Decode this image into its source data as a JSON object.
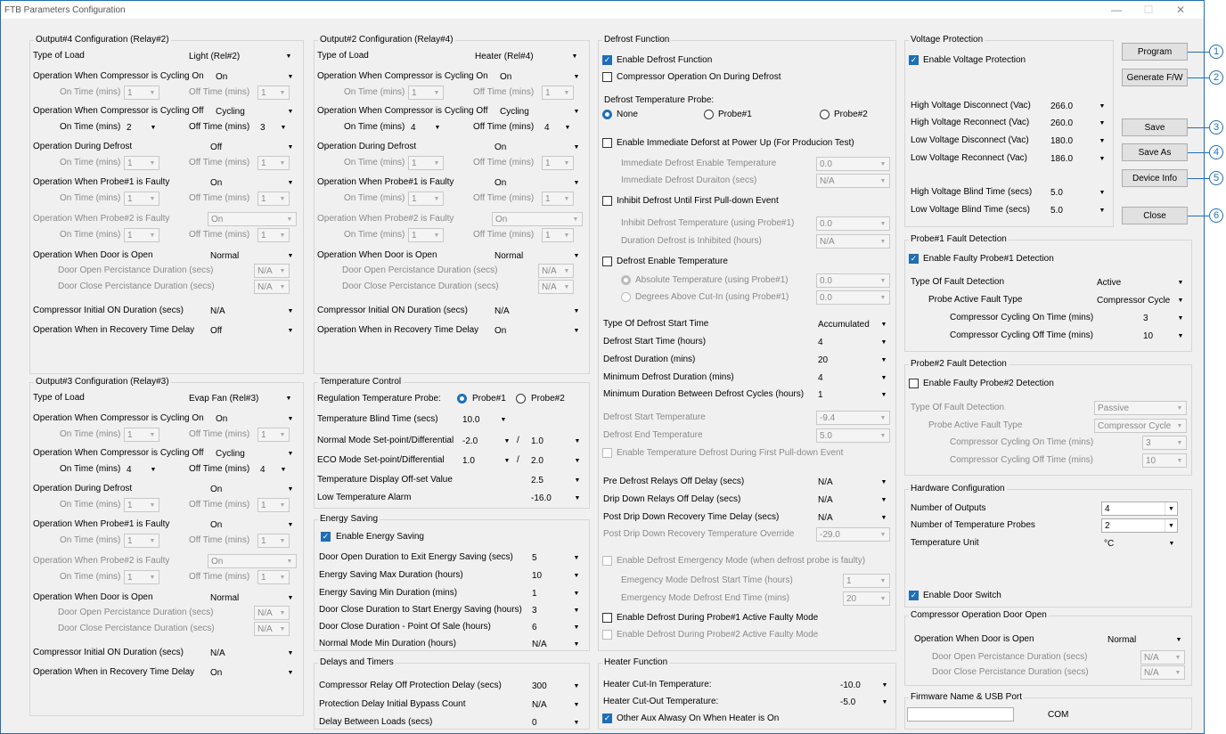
{
  "window": {
    "title": "FTB Parameters Configuration",
    "minimize": "—",
    "maximize": "☐",
    "close": "✕"
  },
  "out4": {
    "title": "Output#4 Configuration (Relay#2)",
    "type_label": "Type of Load",
    "type_value": "Light (Rel#2)",
    "cyc_on_label": "Operation When Compressor is Cycling On",
    "cyc_on_value": "On",
    "ontime": "On Time (mins)",
    "offtime": "Off Time (mins)",
    "cyc_on_on": "1",
    "cyc_on_off": "1",
    "cyc_off_label": "Operation When Compressor is Cycling Off",
    "cyc_off_value": "Cycling",
    "cyc_off_on": "2",
    "cyc_off_off": "3",
    "defrost_label": "Operation During Defrost",
    "defrost_value": "Off",
    "def_on": "1",
    "def_off": "1",
    "p1_label": "Operation When Probe#1 is Faulty",
    "p1_value": "On",
    "p1_on": "1",
    "p1_off": "1",
    "p2_label": "Operation When Probe#2 is Faulty",
    "p2_value": "On",
    "p2_on": "1",
    "p2_off": "1",
    "door_label": "Operation When Door is Open",
    "door_value": "Normal",
    "dopen_label": "Door Open Percistance Duration (secs)",
    "dopen_value": "N/A",
    "dclose_label": "Door Close Percistance Duration (secs)",
    "dclose_value": "N/A",
    "cinit_label": "Compressor Initial ON Duration (secs)",
    "cinit_value": "N/A",
    "recov_label": "Operation When in Recovery Time Delay",
    "recov_value": "Off"
  },
  "out3": {
    "title": "Output#3 Configuration (Relay#3)",
    "type_label": "Type of Load",
    "type_value": "Evap Fan (Rel#3)",
    "cyc_on_label": "Operation When Compressor is Cycling On",
    "cyc_on_value": "On",
    "ontime": "On Time (mins)",
    "offtime": "Off Time (mins)",
    "cyc_on_on": "1",
    "cyc_on_off": "1",
    "cyc_off_label": "Operation When Compressor is Cycling Off",
    "cyc_off_value": "Cycling",
    "cyc_off_on": "4",
    "cyc_off_off": "4",
    "defrost_label": "Operation During Defrost",
    "defrost_value": "On",
    "def_on": "1",
    "def_off": "1",
    "p1_label": "Operation When Probe#1 is Faulty",
    "p1_value": "On",
    "p1_on": "1",
    "p1_off": "1",
    "p2_label": "Operation When Probe#2 is Faulty",
    "p2_value": "On",
    "p2_on": "1",
    "p2_off": "1",
    "door_label": "Operation When Door is Open",
    "door_value": "Normal",
    "dopen_label": "Door Open Percistance Duration (secs)",
    "dopen_value": "N/A",
    "dclose_label": "Door Close Percistance Duration (secs)",
    "dclose_value": "N/A",
    "cinit_label": "Compressor Initial ON Duration (secs)",
    "cinit_value": "N/A",
    "recov_label": "Operation When in Recovery Time Delay",
    "recov_value": "On"
  },
  "out2": {
    "title": "Output#2 Configuration (Relay#4)",
    "type_label": "Type of Load",
    "type_value": "Heater (Rel#4)",
    "cyc_on_label": "Operation When Compressor is Cycling On",
    "cyc_on_value": "On",
    "ontime": "On Time (mins)",
    "offtime": "Off Time (mins)",
    "cyc_on_on": "1",
    "cyc_on_off": "1",
    "cyc_off_label": "Operation When Compressor is Cycling Off",
    "cyc_off_value": "Cycling",
    "cyc_off_on": "4",
    "cyc_off_off": "4",
    "defrost_label": "Operation During Defrost",
    "defrost_value": "On",
    "def_on": "1",
    "def_off": "1",
    "p1_label": "Operation When Probe#1 is Faulty",
    "p1_value": "On",
    "p1_on": "1",
    "p1_off": "1",
    "p2_label": "Operation When Probe#2 is Faulty",
    "p2_value": "On",
    "p2_on": "1",
    "p2_off": "1",
    "door_label": "Operation When Door is Open",
    "door_value": "Normal",
    "dopen_label": "Door Open Percistance Duration (secs)",
    "dopen_value": "N/A",
    "dclose_label": "Door Close Percistance Duration (secs)",
    "dclose_value": "N/A",
    "cinit_label": "Compressor Initial ON Duration (secs)",
    "cinit_value": "N/A",
    "recov_label": "Operation When in Recovery Time Delay",
    "recov_value": "On"
  },
  "temp": {
    "title": "Temperature Control",
    "probe_label": "Regulation Temperature Probe:",
    "probe1": "Probe#1",
    "probe2": "Probe#2",
    "blind_label": "Temperature Blind Time (secs)",
    "blind_value": "10.0",
    "normal_label": "Normal Mode Set-point/Differential",
    "normal_sp": "-2.0",
    "normal_diff": "1.0",
    "eco_label": "ECO Mode Set-point/Differential",
    "eco_sp": "1.0",
    "eco_diff": "2.0",
    "offset_label": "Temperature Display Off-set Value",
    "offset_value": "2.5",
    "alarm_label": "Low Temperature Alarm",
    "alarm_value": "-16.0",
    "slash": "/"
  },
  "energy": {
    "title": "Energy Saving",
    "enable": "Enable Energy Saving",
    "r1_label": "Door Open Duration to Exit Energy Saving (secs)",
    "r1": "5",
    "r2_label": "Energy Saving Max Duration (hours)",
    "r2": "10",
    "r3_label": "Energy Saving Min Duration (mins)",
    "r3": "1",
    "r4_label": "Door Close Duration to Start Energy Saving (hours)",
    "r4": "3",
    "r5_label": "Door Close Duration - Point Of Sale (hours)",
    "r5": "6",
    "r6_label": "Normal Mode Min Duration (hours)",
    "r6": "N/A"
  },
  "delays": {
    "title": "Delays and Timers",
    "r1_label": "Compressor Relay Off Protection Delay (secs)",
    "r1": "300",
    "r2_label": "Protection Delay Initial Bypass Count",
    "r2": "N/A",
    "r3_label": "Delay Between Loads (secs)",
    "r3": "0"
  },
  "defrost": {
    "title": "Defrost Function",
    "enable": "Enable Defrost Function",
    "comp_on": "Compressor Operation On During Defrost",
    "probe_label": "Defrost Temperature Probe:",
    "none": "None",
    "probe1": "Probe#1",
    "probe2": "Probe#2",
    "imm_label": "Enable Immediate Deforst at Power Up (For Producion Test)",
    "imm_temp_label": "Immediate Defrost Enable Temperature",
    "imm_temp": "0.0",
    "imm_dur_label": "Immediate Defrost Duraiton (secs)",
    "imm_dur": "N/A",
    "inhibit_label": "Inhibit Defrost Until First Pull-down Event",
    "inh_temp_label": "Inhibit Defrost Temperature (using Probe#1)",
    "inh_temp": "0.0",
    "inh_dur_label": "Duration Defrost is Inhibited (hours)",
    "inh_dur": "N/A",
    "enable_temp_label": "Defrost Enable Temperature",
    "abs_label": "Absolute Temperature (using Probe#1)",
    "abs": "0.0",
    "deg_label": "Degrees Above Cut-In (using Probe#1)",
    "deg": "0.0",
    "start_type_label": "Type Of Defrost Start Time",
    "start_type": "Accumulated",
    "start_time_label": "Defrost Start Time (hours)",
    "start_time": "4",
    "dur_label": "Defrost Duration (mins)",
    "dur": "20",
    "min_dur_label": "Minimum Defrost Duration (mins)",
    "min_dur": "4",
    "min_between_label": "Minimum Duration Between Defrost Cycles (hours)",
    "min_between": "1",
    "start_temp_label": "Defrost Start Temperature",
    "start_temp": "-9.4",
    "end_temp_label": "Defrost End Temperature",
    "end_temp": "5.0",
    "en_first_label": "Enable Temperature Defrost During First Pull-down Event",
    "pre_label": "Pre Defrost Relays Off Delay (secs)",
    "pre": "N/A",
    "drip_label": "Drip Down Relays Off Delay (secs)",
    "drip": "N/A",
    "post_label": "Post Drip Down Recovery Time Delay (secs)",
    "post": "N/A",
    "post_temp_label": "Post Drip Down Recovery Temperature Override",
    "post_temp": "-29.0",
    "emerg_label": "Enable Defrost Emergency Mode (when defrost probe is faulty)",
    "em_start_label": "Emegency Mode Defrost Start Time (hours)",
    "em_start": "1",
    "em_end_label": "Emergency Mode Defrost End Time (mins)",
    "em_end": "20",
    "p1_faulty": "Enable Defrost During Probe#1 Active Faulty Mode",
    "p2_faulty": "Enable Defrost During Probe#2 Active Faulty Mode"
  },
  "heater": {
    "title": "Heater Function",
    "cutin_label": "Heater Cut-In Temperature:",
    "cutin": "-10.0",
    "cutout_label": "Heater Cut-Out Temperature:",
    "cutout": "-5.0",
    "aux_label": "Other Aux Alwasy On When Heater is On"
  },
  "voltage": {
    "title": "Voltage Protection",
    "enable": "Enable Voltage Protection",
    "hvd_label": "High Voltage Disconnect (Vac)",
    "hvd": "266.0",
    "hvr_label": "High Voltage Reconnect (Vac)",
    "hvr": "260.0",
    "lvd_label": "Low Voltage Disconnect (Vac)",
    "lvd": "180.0",
    "lvr_label": "Low Voltage Reconnect (Vac)",
    "lvr": "186.0",
    "hvb_label": "High Voltage Blind Time (secs)",
    "hvb": "5.0",
    "lvb_label": "Low Voltage Blind Time (secs)",
    "lvb": "5.0"
  },
  "buttons": {
    "program": "Program",
    "generate": "Generate F/W",
    "save": "Save",
    "saveas": "Save As",
    "devinfo": "Device Info",
    "close": "Close",
    "n1": "1",
    "n2": "2",
    "n3": "3",
    "n4": "4",
    "n5": "5",
    "n6": "6"
  },
  "probe1fault": {
    "title": "Probe#1 Fault Detection",
    "enable": "Enable Faulty Probe#1 Detection",
    "type_label": "Type Of Fault Detection",
    "type": "Active",
    "active_label": "Probe Active Fault Type",
    "active": "Compressor Cycle",
    "on_label": "Compressor Cycling On Time (mins)",
    "on": "3",
    "off_label": "Compressor Cycling Off Time (mins)",
    "off": "10"
  },
  "probe2fault": {
    "title": "Probe#2 Fault Detection",
    "enable": "Enable Faulty Probe#2 Detection",
    "type_label": "Type Of Fault Detection",
    "type": "Passive",
    "active_label": "Probe Active Fault Type",
    "active": "Compressor Cycle",
    "on_label": "Compressor Cycling On Time (mins)",
    "on": "3",
    "off_label": "Compressor Cycling Off Time (mins)",
    "off": "10"
  },
  "hardware": {
    "title": "Hardware Configuration",
    "outputs_label": "Number of Outputs",
    "outputs": "4",
    "probes_label": "Number of Temperature Probes",
    "probes": "2",
    "unit_label": "Temperature Unit",
    "unit": "°C",
    "door_switch": "Enable Door Switch"
  },
  "compdoor": {
    "title": "Compressor Operation Door Open",
    "door_label": "Operation When Door is Open",
    "door": "Normal",
    "dopen_label": "Door Open Percistance Duration (secs)",
    "dopen": "N/A",
    "dclose_label": "Door Close Percistance Duration (secs)",
    "dclose": "N/A"
  },
  "firmware": {
    "title": "Firmware Name & USB Port",
    "com": "COM"
  }
}
